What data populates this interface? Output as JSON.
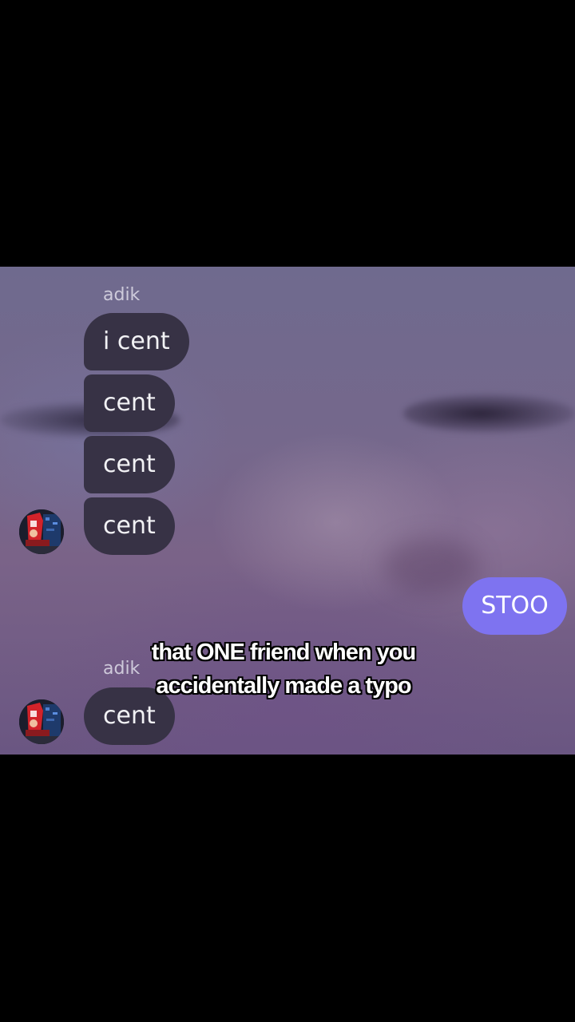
{
  "chat": {
    "messages_group_1": {
      "sender": "adik",
      "messages": [
        "i cent",
        "cent",
        "cent",
        "cent"
      ]
    },
    "my_message": "STOO",
    "messages_group_2": {
      "sender": "adik",
      "messages": [
        "cent"
      ]
    }
  },
  "caption": {
    "text": "that ONE friend when you accidentally made a typo"
  },
  "colors": {
    "incoming_bubble": "#373245",
    "outgoing_bubble": "#7e73f0",
    "letterbox": "#000000"
  },
  "icons": {
    "avatar": "avatar-image"
  }
}
